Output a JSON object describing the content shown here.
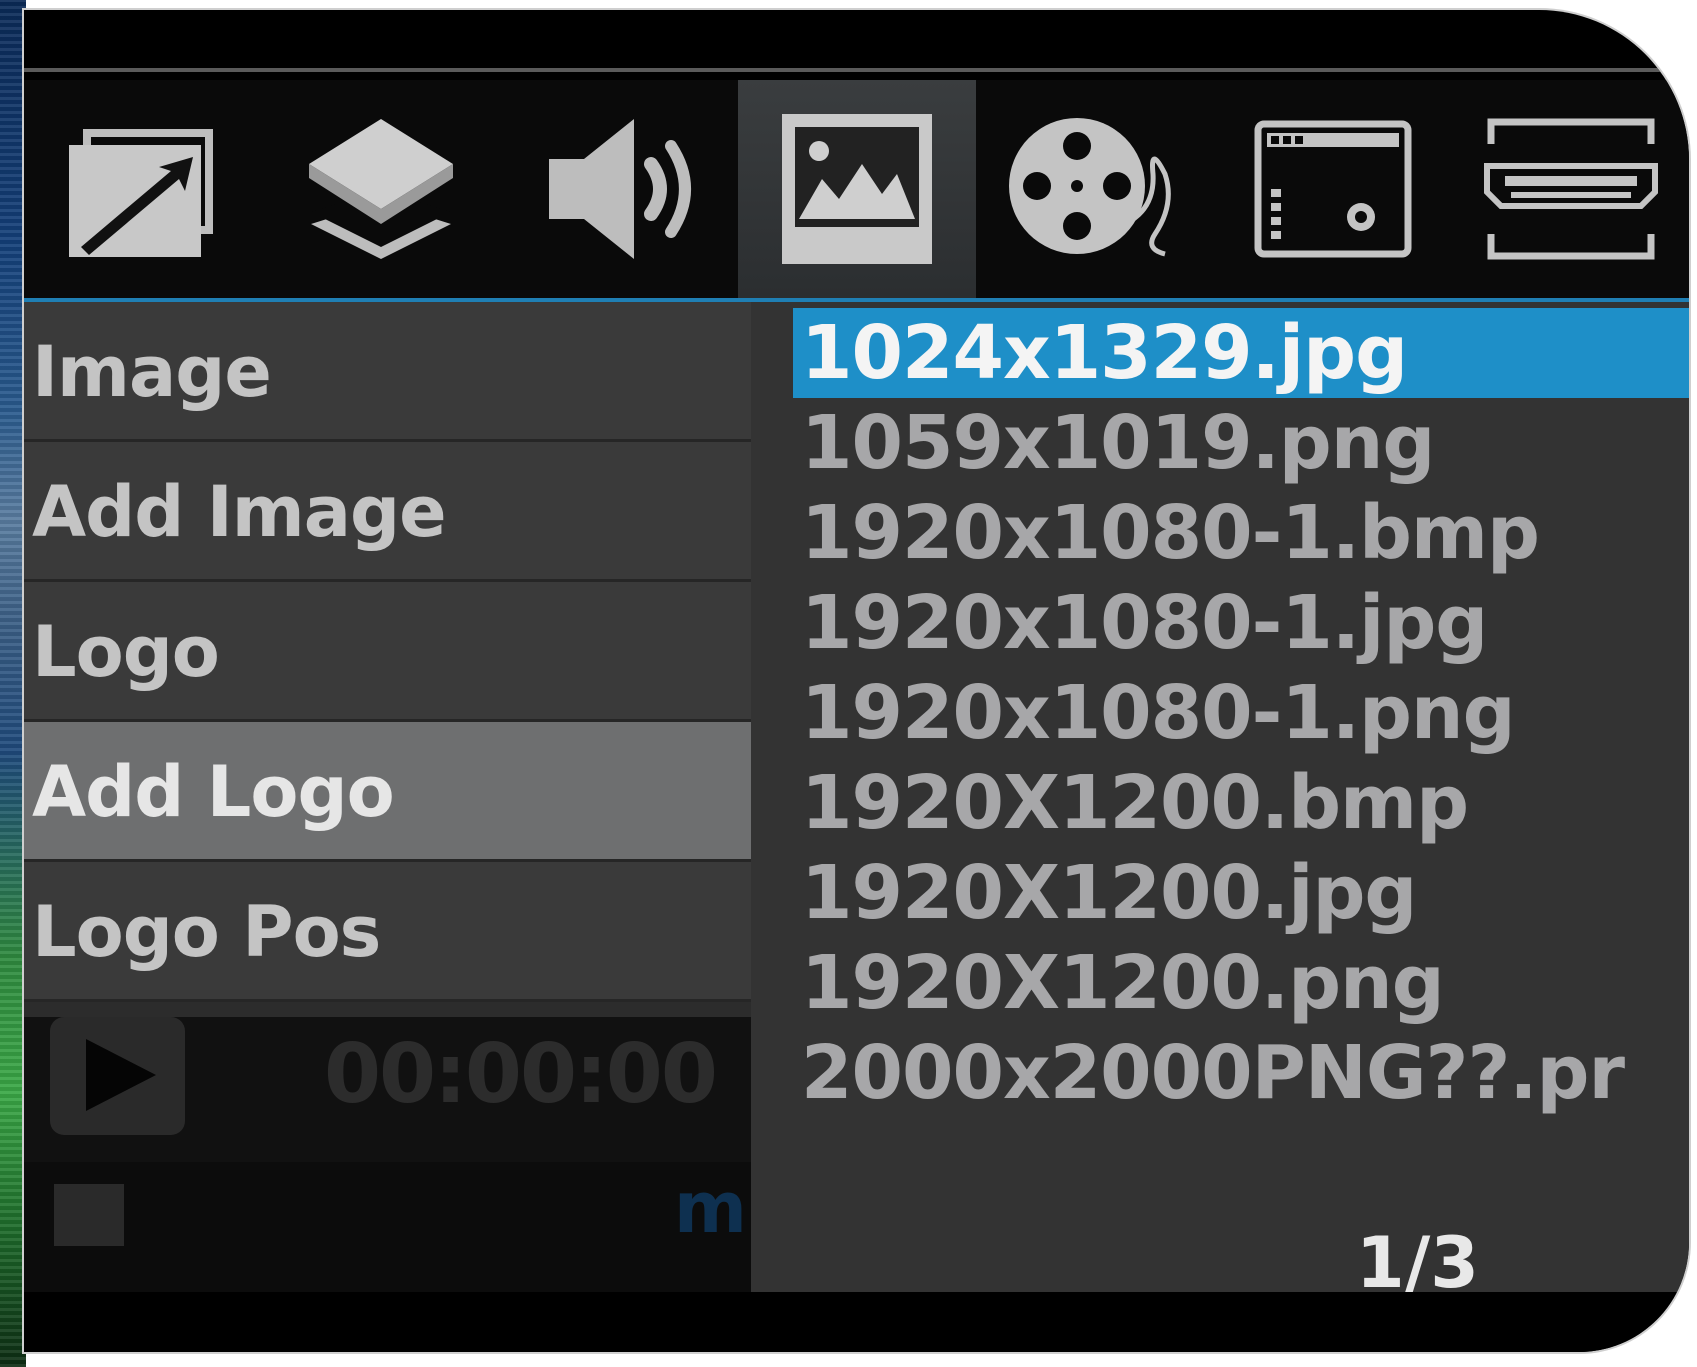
{
  "tabs": [
    {
      "name": "picture-size-icon"
    },
    {
      "name": "layers-icon"
    },
    {
      "name": "audio-icon"
    },
    {
      "name": "image-icon",
      "active": true
    },
    {
      "name": "video-reel-icon"
    },
    {
      "name": "system-settings-icon"
    },
    {
      "name": "hdmi-icon"
    }
  ],
  "menu": {
    "items": [
      {
        "label": "Image"
      },
      {
        "label": "Add Image"
      },
      {
        "label": "Logo"
      },
      {
        "label": "Add Logo",
        "selected": true
      },
      {
        "label": "Logo Pos"
      }
    ]
  },
  "player": {
    "timecode": "00:00:00",
    "bottom_glyph": "m"
  },
  "files": {
    "items": [
      {
        "name": "1024x1329.jpg",
        "selected": true
      },
      {
        "name": "1059x1019.png"
      },
      {
        "name": "1920x1080-1.bmp"
      },
      {
        "name": "1920x1080-1.jpg"
      },
      {
        "name": "1920x1080-1.png"
      },
      {
        "name": "1920X1200.bmp"
      },
      {
        "name": "1920X1200.jpg"
      },
      {
        "name": "1920X1200.png"
      },
      {
        "name": "2000x2000PNG??.pr"
      }
    ],
    "page": "1/3"
  },
  "colors": {
    "accent": "#1e8fc8",
    "menu_bg": "#3a3a3a",
    "menu_selected": "#6e6f70",
    "list_bg": "#333333"
  }
}
